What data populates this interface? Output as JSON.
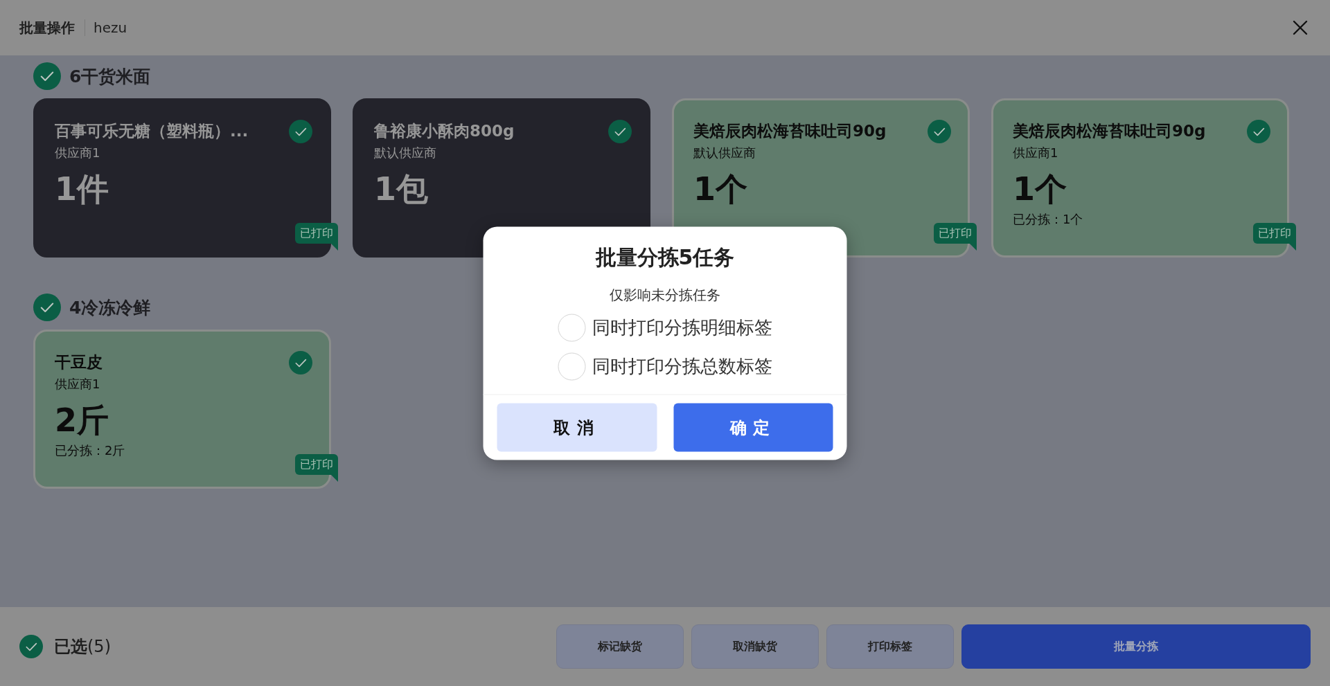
{
  "header": {
    "title": "批量操作",
    "subtitle": "hezu"
  },
  "sections": [
    {
      "title": "6干货米面",
      "checked": true,
      "cards": [
        {
          "kind": "pending",
          "name": "百事可乐无糖（塑料瓶）...",
          "supplier": "供应商1",
          "quantity": "1件",
          "checked": true,
          "tag": "已打印"
        },
        {
          "kind": "pending",
          "name": "鲁裕康小酥肉800g",
          "supplier": "默认供应商",
          "quantity": "1包",
          "checked": true
        },
        {
          "kind": "sorted",
          "name": "美焙辰肉松海苔味吐司90g",
          "supplier": "默认供应商",
          "quantity": "1个",
          "checked": true,
          "tag": "已打印"
        },
        {
          "kind": "sorted",
          "name": "美焙辰肉松海苔味吐司90g",
          "supplier": "供应商1",
          "quantity": "1个",
          "sorted_text": "已分拣：1个",
          "checked": true,
          "tag": "已打印"
        }
      ]
    },
    {
      "title": "4冷冻冷鲜",
      "checked": true,
      "cards": [
        {
          "kind": "sorted",
          "name": "干豆皮",
          "supplier": "供应商1",
          "quantity": "2斤",
          "sorted_text": "已分拣：2斤",
          "checked": true,
          "tag": "已打印"
        }
      ]
    }
  ],
  "footer": {
    "select_all": {
      "checked": true,
      "label": "**已选**(5)"
    },
    "buttons": [
      {
        "label": "标记缺货",
        "kind": "secondary"
      },
      {
        "label": "取消缺货",
        "kind": "secondary"
      },
      {
        "label": "打印标签",
        "kind": "secondary"
      },
      {
        "label": "批量分拣",
        "kind": "primary"
      }
    ]
  },
  "dialog": {
    "title": "批量分拣5任务",
    "note": "仅影响未分拣任务",
    "options": [
      {
        "label": "同时打印分拣明细标签",
        "checked": false
      },
      {
        "label": "同时打印分拣总数标签",
        "checked": false
      }
    ],
    "buttons": [
      {
        "label": "取消",
        "kind": "cancel"
      },
      {
        "label": "确定",
        "kind": "confirm"
      }
    ]
  }
}
